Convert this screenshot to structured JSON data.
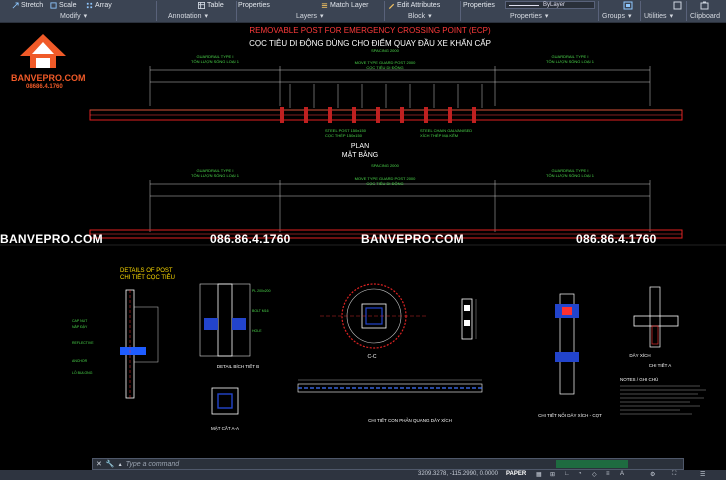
{
  "ribbon": {
    "tools": [
      {
        "label": "Stretch",
        "icon": "stretch-icon"
      },
      {
        "label": "Scale",
        "icon": "scale-icon"
      },
      {
        "label": "Array",
        "icon": "array-icon"
      },
      {
        "label": "Table",
        "icon": "table-icon"
      },
      {
        "label": "Properties",
        "icon": "properties-icon"
      },
      {
        "label": "Match Layer",
        "icon": "match-layer-icon"
      },
      {
        "label": "Edit Attributes",
        "icon": "edit-attributes-icon"
      },
      {
        "label": "Properties",
        "icon": "properties-icon"
      }
    ],
    "panels": [
      "Modify",
      "Annotation",
      "Layers",
      "Block",
      "Properties",
      "Groups",
      "Utilities",
      "Clipboard"
    ],
    "bylayer": "ByLayer"
  },
  "drawing": {
    "title_en": "REMOVABLE POST FOR EMERGENCY CROSSING POINT (ECP)",
    "title_vi": "CỌC TIÊU DI ĐỘNG DÙNG CHO ĐIỂM QUAY ĐẦU XE KHẨN CẤP",
    "plan_label": "PLAN",
    "plan_label_vi": "MẶT BẰNG",
    "details_title": "DETAILS OF POST",
    "details_title_vi": "CHI TIẾT CỌC TIÊU",
    "caption_detail_b": "DETAIL BÍCH TIẾT B",
    "caption_section_aa": "MẶT CẮT A-A",
    "caption_cc": "C-C",
    "caption_reflector": "CHI TIẾT CON PHẢN QUANG DÂY XÍCH",
    "caption_knot": "CHI TIẾT NỐI DÂY XÍCH - CỌT",
    "caption_detail_a": "CHI TIẾT A",
    "caption_chain": "DÂY XÍCH",
    "notes_title": "NOTES / GHI CHÚ"
  },
  "watermarks": {
    "brand": "BANVEPRO.COM",
    "phone": "086.86.4.1760"
  },
  "logo": {
    "name": "BANVEPRO.COM",
    "phone": "08686.4.1760"
  },
  "command": {
    "placeholder": "Type a command"
  },
  "status": {
    "coords": "3209.3278, -115.2990, 0.0000",
    "mode": "PAPER"
  }
}
